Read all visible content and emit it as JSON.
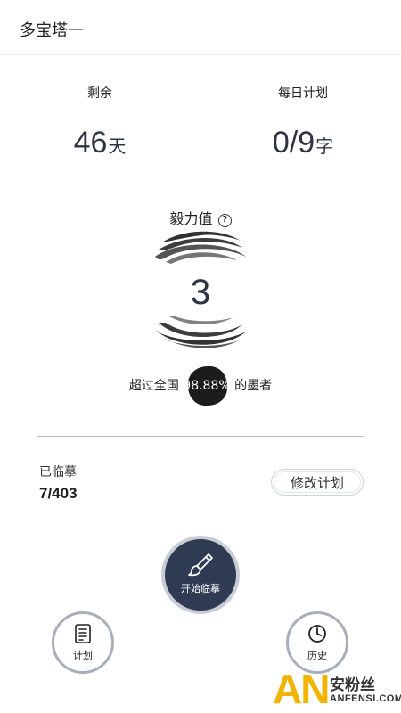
{
  "header": {
    "title": "多宝塔一"
  },
  "stats": {
    "remaining": {
      "label": "剩余",
      "value": "46",
      "unit": "天"
    },
    "daily_plan": {
      "label": "每日计划",
      "value": "0/9",
      "unit": "字"
    }
  },
  "perseverance": {
    "label": "毅力值",
    "help": "?",
    "score": "3",
    "beat_prefix": "超过全国",
    "beat_percent": "98.88%",
    "beat_suffix": "的墨者"
  },
  "progress": {
    "label": "已临摹",
    "value": "7/403",
    "edit_button": "修改计划"
  },
  "actions": {
    "start": {
      "label": "开始临摹",
      "icon": "brush-icon"
    },
    "plan": {
      "label": "计划",
      "icon": "document-list-icon"
    },
    "history": {
      "label": "历史",
      "icon": "clock-icon"
    }
  },
  "watermark": {
    "logo": "AN",
    "cn": "安粉丝",
    "en": "ANFENSI.COM"
  },
  "colors": {
    "accent": "#2f3b52",
    "ring": "#a9afba",
    "watermark": "#f2b400"
  }
}
